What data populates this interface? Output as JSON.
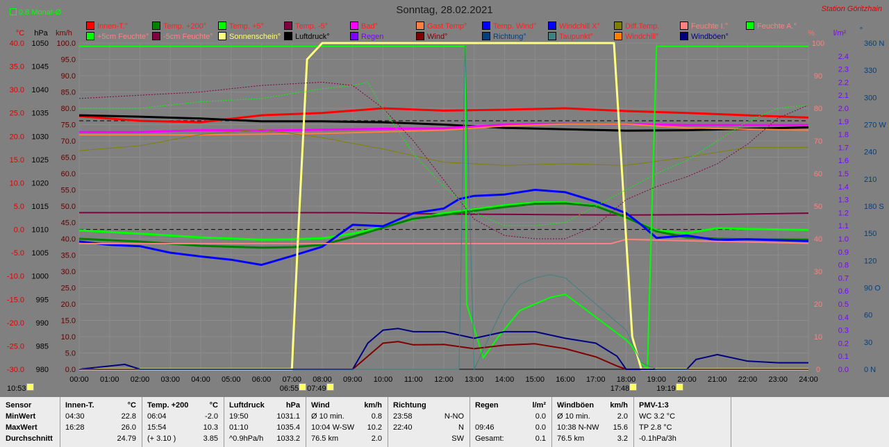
{
  "title": "Sonntag, 28.02.2021",
  "station": "Station Göritzhain",
  "avg_label": "0.8 Monat-Ø",
  "legend": [
    {
      "label": "Innen-T.°",
      "color": "#ff0000",
      "text_color": "#ff2020"
    },
    {
      "label": "Temp. +200°",
      "color": "#008000",
      "text_color": "#ff2020"
    },
    {
      "label": "Temp. +5°",
      "color": "#00ff00",
      "text_color": "#ff2020"
    },
    {
      "label": "Temp. -5°",
      "color": "#800040",
      "text_color": "#ff2020"
    },
    {
      "label": "Bad°",
      "color": "#ff00ff",
      "text_color": "#ff2020"
    },
    {
      "label": "Gast Temp°",
      "color": "#ff8040",
      "text_color": "#ff2020"
    },
    {
      "label": "Temp. Wind°",
      "color": "#0000ff",
      "text_color": "#ff2020"
    },
    {
      "label": "Windchill X°",
      "color": "#0000ff",
      "text_color": "#ff2020"
    },
    {
      "label": "Diff.Temp.",
      "color": "#808000",
      "text_color": "#ff2020"
    },
    {
      "label": "Feuchte I.°",
      "color": "#ff8080",
      "text_color": "#ff8080"
    },
    {
      "label": "Feuchte A.°",
      "color": "#00ff00",
      "text_color": "#ff8080"
    },
    {
      "label": "+5cm Feuchte°",
      "color": "#00ff00",
      "text_color": "#ff8080"
    },
    {
      "label": "-5cm Feuchte°",
      "color": "#800040",
      "text_color": "#ff8080"
    },
    {
      "label": "Sonnenschein°",
      "color": "#ffff80",
      "text_color": "#ffff80"
    },
    {
      "label": "Luftdruck°",
      "color": "#000000",
      "text_color": "#000000"
    },
    {
      "label": "Regen",
      "color": "#8000ff",
      "text_color": "#8000ff"
    },
    {
      "label": "Wind°",
      "color": "#800000",
      "text_color": "#800000"
    },
    {
      "label": "Richtung°",
      "color": "#004080",
      "text_color": "#004080"
    },
    {
      "label": "Taupunkt°",
      "color": "#408080",
      "text_color": "#ff2020"
    },
    {
      "label": "Windchill°",
      "color": "#ff8000",
      "text_color": "#ff2020"
    },
    {
      "label": "Windböen°",
      "color": "#000080",
      "text_color": "#000080"
    }
  ],
  "axis_headers": {
    "temp": "°C",
    "press": "hPa",
    "wind": "km/h",
    "hum": "%",
    "rain": "l/m²",
    "dir": "°"
  },
  "chart_data": {
    "type": "line",
    "title": "Sonntag, 28.02.2021",
    "x_ticks": [
      "00:00",
      "01:00",
      "02:00",
      "03:00",
      "04:00",
      "05:00",
      "06:00",
      "07:00",
      "08:00",
      "09:00",
      "10:00",
      "11:00",
      "12:00",
      "13:00",
      "14:00",
      "15:00",
      "16:00",
      "17:00",
      "18:00",
      "19:00",
      "20:00",
      "21:00",
      "22:00",
      "23:00",
      "24:00"
    ],
    "xlim": [
      0,
      24
    ],
    "y_axes": {
      "temp": {
        "ticks": [
          "40.0",
          "35.0",
          "30.0",
          "25.0",
          "20.0",
          "15.0",
          "10.0",
          "5.0",
          "0.0",
          "-5.0",
          "-10.0",
          "-15.0",
          "-20.0",
          "-25.0",
          "-30.0"
        ],
        "range": [
          -30,
          40
        ]
      },
      "pressure": {
        "ticks": [
          "1050",
          "1045",
          "1040",
          "1035",
          "1030",
          "1025",
          "1020",
          "1015",
          "1010",
          "1005",
          "1000",
          "995",
          "990",
          "985",
          "980"
        ],
        "range": [
          980,
          1050
        ]
      },
      "wind": {
        "ticks": [
          "100.0",
          "95.0",
          "90.0",
          "85.0",
          "80.0",
          "75.0",
          "70.0",
          "65.0",
          "60.0",
          "55.0",
          "50.0",
          "45.0",
          "40.0",
          "35.0",
          "30.0",
          "25.0",
          "20.0",
          "15.0",
          "10.0",
          "5.0",
          "0.0"
        ],
        "range": [
          0,
          100
        ]
      },
      "humidity": {
        "ticks": [
          "100",
          "90",
          "80",
          "70",
          "60",
          "50",
          "40",
          "30",
          "20",
          "10",
          "0"
        ],
        "range": [
          0,
          100
        ]
      },
      "rain": {
        "ticks": [
          "2.4",
          "2.3",
          "2.2",
          "2.1",
          "2.0",
          "1.9",
          "1.8",
          "1.7",
          "1.6",
          "1.5",
          "1.4",
          "1.3",
          "1.2",
          "1.1",
          "1.0",
          "0.9",
          "0.8",
          "0.7",
          "0.6",
          "0.5",
          "0.4",
          "0.3",
          "0.2",
          "0.1",
          "0.0"
        ],
        "range": [
          0,
          2.5
        ]
      },
      "direction": {
        "ticks": [
          "360 N",
          "330",
          "300",
          "270 W",
          "240",
          "210",
          "180 S",
          "150",
          "120",
          "90 O",
          "60",
          "30",
          "0 N"
        ],
        "range": [
          0,
          360
        ]
      }
    },
    "series": [
      {
        "name": "Innen-T.°",
        "color": "#ff0000",
        "width": 3,
        "x": [
          0,
          2,
          4,
          6,
          8,
          10,
          12,
          14,
          16,
          18,
          20,
          22,
          24
        ],
        "y": [
          24.3,
          23.3,
          23.0,
          24.5,
          25.0,
          26.0,
          25.5,
          25.7,
          26.0,
          25.4,
          25.0,
          24.5,
          24.0
        ]
      },
      {
        "name": "Luftdruck°",
        "color": "#000000",
        "width": 3,
        "x": [
          0,
          2,
          4,
          6,
          8,
          10,
          12,
          14,
          16,
          18,
          20,
          22,
          24
        ],
        "y": [
          1034.5,
          1034.2,
          1033.8,
          1033.2,
          1033.2,
          1033.0,
          1032.5,
          1031.8,
          1031.5,
          1031.2,
          1031.3,
          1031.6,
          1031.9
        ]
      },
      {
        "name": "Bad°",
        "color": "#ff00ff",
        "width": 3,
        "x": [
          0,
          2,
          4,
          6,
          8,
          10,
          12,
          14,
          16,
          18,
          20,
          22,
          24
        ],
        "y": [
          20.9,
          20.9,
          21.3,
          21.2,
          21.4,
          21.6,
          21.7,
          22.5,
          22.7,
          22.6,
          22.4,
          22.4,
          22.4
        ]
      },
      {
        "name": "Gast Temp°",
        "color": "#ff8040",
        "width": 2,
        "x": [
          0,
          4,
          8,
          12,
          14,
          16,
          18,
          20,
          24
        ],
        "y": [
          20.3,
          20.3,
          20.6,
          21.3,
          22.2,
          22.6,
          22.6,
          21.8,
          21.3
        ]
      },
      {
        "name": "Temp. -5°",
        "color": "#800040",
        "width": 2,
        "x": [
          0,
          6,
          9,
          12,
          15,
          18,
          21,
          24
        ],
        "y": [
          3.6,
          3.6,
          3.6,
          3.3,
          3.2,
          3.1,
          3.2,
          3.5
        ]
      },
      {
        "name": "Temp. +5°",
        "color": "#00ff00",
        "width": 3,
        "x": [
          0,
          2,
          4,
          6,
          7,
          8,
          9,
          10,
          11,
          12,
          13,
          14,
          15,
          16,
          17,
          18,
          19,
          20,
          21,
          22,
          24
        ],
        "y": [
          -0.2,
          -0.9,
          -1.7,
          -2.2,
          -2.1,
          -1.9,
          -0.9,
          0.5,
          2.2,
          3.5,
          4.3,
          5.2,
          5.8,
          5.8,
          5.1,
          2.5,
          -0.2,
          -0.8,
          0.3,
          0.1,
          -0.1
        ]
      },
      {
        "name": "Temp. +200°",
        "color": "#008000",
        "width": 3,
        "x": [
          0,
          2,
          4,
          6,
          7,
          8,
          9,
          10,
          11,
          12,
          13,
          14,
          15,
          16,
          17,
          18,
          19,
          20,
          21,
          22,
          24
        ],
        "y": [
          -2.0,
          -2.6,
          -3.5,
          -3.9,
          -3.8,
          -3.3,
          -1.6,
          0.4,
          2.3,
          3.1,
          4.0,
          4.8,
          5.5,
          5.6,
          5.0,
          2.6,
          -0.4,
          -1.7,
          -2.0,
          -2.1,
          -2.2
        ]
      },
      {
        "name": "Temp. Wind°",
        "color": "#0000ff",
        "width": 3,
        "x": [
          0,
          1,
          2,
          3,
          4,
          5,
          6,
          7,
          8,
          9,
          10,
          11,
          12,
          12.5,
          13,
          14,
          15,
          16,
          17,
          18,
          18.5,
          19,
          20,
          21,
          22,
          24
        ],
        "y": [
          -2.6,
          -3.3,
          -3.6,
          -5.0,
          -5.8,
          -6.5,
          -7.6,
          -5.7,
          -3.7,
          1.0,
          0.7,
          3.5,
          4.5,
          6.5,
          7.2,
          7.5,
          8.5,
          8.0,
          6.0,
          3.5,
          1.0,
          -1.8,
          -1.3,
          -2.3,
          -2.1,
          -2.5
        ]
      },
      {
        "name": "Feuchte I.°",
        "color": "#ff8080",
        "width": 2,
        "x": [
          0,
          6,
          12,
          17.5,
          18,
          19,
          24
        ],
        "y": [
          38.5,
          38.5,
          38.5,
          38.5,
          39.8,
          39.6,
          38.6
        ]
      },
      {
        "name": "Diff.Temp.",
        "color": "#808000",
        "width": 1,
        "x": [
          0,
          2,
          4,
          6,
          8,
          10,
          12,
          14,
          16,
          18,
          20,
          22,
          24
        ],
        "y": [
          67,
          68.5,
          72,
          73.5,
          71,
          67.5,
          63.5,
          62.5,
          63,
          62.5,
          65,
          68,
          68
        ]
      },
      {
        "name": "Feuchte A.°",
        "color": "#00ff00",
        "width": 2,
        "x": [
          0,
          7,
          7.3,
          12.7,
          12.75,
          13.3,
          13.8,
          14.5,
          15.5,
          16,
          17,
          18,
          18.2,
          18.5,
          18.7,
          19,
          24
        ],
        "y": [
          99,
          99,
          99,
          99,
          20,
          3.5,
          10,
          18,
          22,
          23,
          16,
          9,
          7,
          2,
          0,
          99,
          99
        ]
      },
      {
        "name": "Sonnenschein°",
        "color": "#ffff80",
        "width": 3,
        "x": [
          0,
          7.0,
          7.2,
          7.5,
          8,
          17.6,
          17.8,
          18.2,
          18.5,
          24
        ],
        "y": [
          0,
          0,
          40,
          95,
          100,
          100,
          70,
          10,
          0,
          0
        ]
      },
      {
        "name": "Wind°",
        "color": "#800000",
        "width": 2,
        "x": [
          0,
          9,
          9.5,
          10,
          10.5,
          11,
          12,
          13,
          14,
          15,
          16,
          17,
          17.7,
          18,
          24
        ],
        "y": [
          0,
          0,
          4,
          8,
          8.5,
          7.5,
          7.6,
          6.3,
          7.4,
          7.8,
          6.3,
          3.8,
          1.0,
          0,
          0
        ]
      },
      {
        "name": "Windböen°",
        "color": "#000080",
        "width": 2,
        "x": [
          0,
          1.5,
          2,
          9,
          9.5,
          10,
          10.5,
          11,
          12,
          13,
          14,
          15,
          16,
          17,
          17.7,
          18,
          20,
          20.3,
          21,
          22,
          23,
          24
        ],
        "y": [
          0,
          1.5,
          0,
          0,
          8,
          12,
          12.5,
          11.5,
          11.5,
          9.5,
          11.5,
          11.5,
          9.5,
          8,
          4,
          0,
          0,
          3.0,
          4.5,
          2.5,
          2.0,
          2.0
        ]
      },
      {
        "name": "Taupunkt°",
        "color": "#408080",
        "width": 1,
        "x": [
          0,
          7,
          12.5,
          12.7,
          13,
          13.5,
          14,
          14.5,
          15,
          15.5,
          16,
          17,
          18,
          18.5,
          19,
          24
        ],
        "y": [
          0,
          0,
          0,
          99,
          0,
          10,
          20,
          26,
          28,
          29,
          28,
          20,
          12,
          2,
          0,
          0
        ]
      },
      {
        "name": "-5cm Feuchte°",
        "color": "#800040",
        "width": 1,
        "style": "dotted",
        "x": [
          0,
          2,
          4,
          6,
          8,
          9,
          10,
          11,
          12,
          13,
          14,
          15,
          16,
          17,
          18,
          19,
          20,
          21,
          22,
          23,
          24
        ],
        "y": [
          83,
          84,
          85,
          87,
          88,
          87,
          80,
          70,
          58,
          46,
          41,
          40,
          40,
          44,
          52,
          56,
          59,
          63,
          69,
          77,
          81
        ]
      },
      {
        "name": "+5cm Feuchte°",
        "color": "#00ff00",
        "width": 1,
        "style": "dotted",
        "x": [
          0,
          2,
          4,
          6,
          8,
          9,
          9.5,
          10,
          11,
          12,
          13,
          14,
          15,
          16,
          17,
          18,
          19,
          20,
          21,
          22,
          23,
          24
        ],
        "y": [
          80,
          80,
          82,
          83,
          86,
          87,
          88,
          80,
          66,
          56,
          48,
          44,
          44,
          45,
          50,
          55,
          60,
          64,
          70,
          76,
          80,
          81
        ]
      }
    ]
  },
  "markers": [
    {
      "time": "10:53",
      "hour": -0.4
    },
    {
      "time": "06:55",
      "hour": 6.92
    },
    {
      "time": "07:49",
      "hour": 7.82
    },
    {
      "time": "17:48",
      "hour": 17.8
    },
    {
      "time": "19:19",
      "hour": 19.32
    }
  ],
  "table": {
    "row_labels": [
      "Sensor",
      "MinWert",
      "MaxWert",
      "Durchschnitt"
    ],
    "columns": [
      {
        "header": "Innen-T.",
        "unit": "°C",
        "rows": [
          [
            "04:30",
            "22.8"
          ],
          [
            "16:28",
            "26.0"
          ],
          [
            "",
            "24.79"
          ]
        ]
      },
      {
        "header": "Temp. +200",
        "unit": "°C",
        "rows": [
          [
            "06:04",
            "-2.0"
          ],
          [
            "15:54",
            "10.3"
          ],
          [
            "(+ 3.10 )",
            "3.85"
          ]
        ]
      },
      {
        "header": "Luftdruck",
        "unit": "hPa",
        "rows": [
          [
            "19:50",
            "1031.1"
          ],
          [
            "01:10",
            "1035.4"
          ],
          [
            "^0.9hPa/h",
            "1033.2"
          ]
        ]
      },
      {
        "header": "Wind",
        "unit": "km/h",
        "rows": [
          [
            "Ø 10 min.",
            "0.8"
          ],
          [
            "10:04     W-SW",
            "10.2"
          ],
          [
            "76.5 km",
            "2.0"
          ]
        ]
      },
      {
        "header": "Richtung",
        "unit": "",
        "rows": [
          [
            "23:58",
            "N-NO"
          ],
          [
            "22:40",
            "N"
          ],
          [
            "",
            "SW"
          ]
        ]
      },
      {
        "header": "Regen",
        "unit": "l/m²",
        "rows": [
          [
            "",
            "0.0"
          ],
          [
            "09:46",
            "0.0"
          ],
          [
            "Gesamt:",
            "0.1"
          ]
        ]
      },
      {
        "header": "Windböen",
        "unit": "km/h",
        "rows": [
          [
            "Ø 10 min.",
            "2.0"
          ],
          [
            "10:38     N-NW",
            "15.6"
          ],
          [
            "76.5 km",
            "3.2"
          ]
        ]
      },
      {
        "header": "PMV-1:3",
        "unit": "",
        "rows": [
          [
            "WC 3.2 °C",
            ""
          ],
          [
            "TP 2.8 °C",
            ""
          ],
          [
            "-0.1hPa/3h",
            ""
          ]
        ]
      }
    ]
  }
}
